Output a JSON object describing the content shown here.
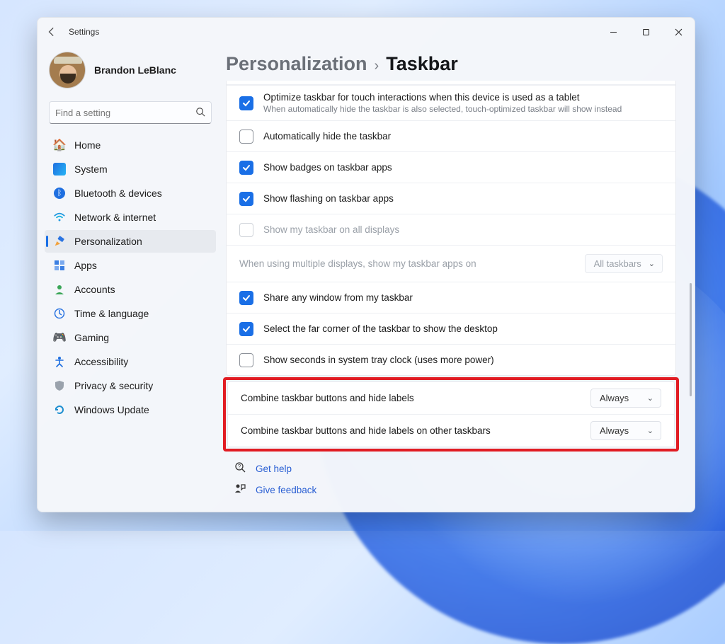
{
  "titlebar": {
    "app": "Settings"
  },
  "profile": {
    "name": "Brandon LeBlanc"
  },
  "search": {
    "placeholder": "Find a setting"
  },
  "sidebar": {
    "items": [
      {
        "label": "Home"
      },
      {
        "label": "System"
      },
      {
        "label": "Bluetooth & devices"
      },
      {
        "label": "Network & internet"
      },
      {
        "label": "Personalization"
      },
      {
        "label": "Apps"
      },
      {
        "label": "Accounts"
      },
      {
        "label": "Time & language"
      },
      {
        "label": "Gaming"
      },
      {
        "label": "Accessibility"
      },
      {
        "label": "Privacy & security"
      },
      {
        "label": "Windows Update"
      }
    ]
  },
  "breadcrumb": {
    "root": "Personalization",
    "leaf": "Taskbar"
  },
  "settings": {
    "optimize_touch": {
      "label": "Optimize taskbar for touch interactions when this device is used as a tablet",
      "description": "When automatically hide the taskbar is also selected, touch-optimized taskbar will show instead",
      "checked": true
    },
    "auto_hide": {
      "label": "Automatically hide the taskbar",
      "checked": false
    },
    "show_badges": {
      "label": "Show badges on taskbar apps",
      "checked": true
    },
    "show_flashing": {
      "label": "Show flashing on taskbar apps",
      "checked": true
    },
    "all_displays": {
      "label": "Show my taskbar on all displays",
      "checked": false
    },
    "multi_display": {
      "caption": "When using multiple displays, show my taskbar apps on",
      "value": "All taskbars"
    },
    "share_window": {
      "label": "Share any window from my taskbar",
      "checked": true
    },
    "far_corner": {
      "label": "Select the far corner of the taskbar to show the desktop",
      "checked": true
    },
    "show_seconds": {
      "label": "Show seconds in system tray clock (uses more power)",
      "checked": false
    },
    "combine_main": {
      "label": "Combine taskbar buttons and hide labels",
      "value": "Always"
    },
    "combine_other": {
      "label": "Combine taskbar buttons and hide labels on other taskbars",
      "value": "Always"
    }
  },
  "links": {
    "help": "Get help",
    "feedback": "Give feedback"
  }
}
